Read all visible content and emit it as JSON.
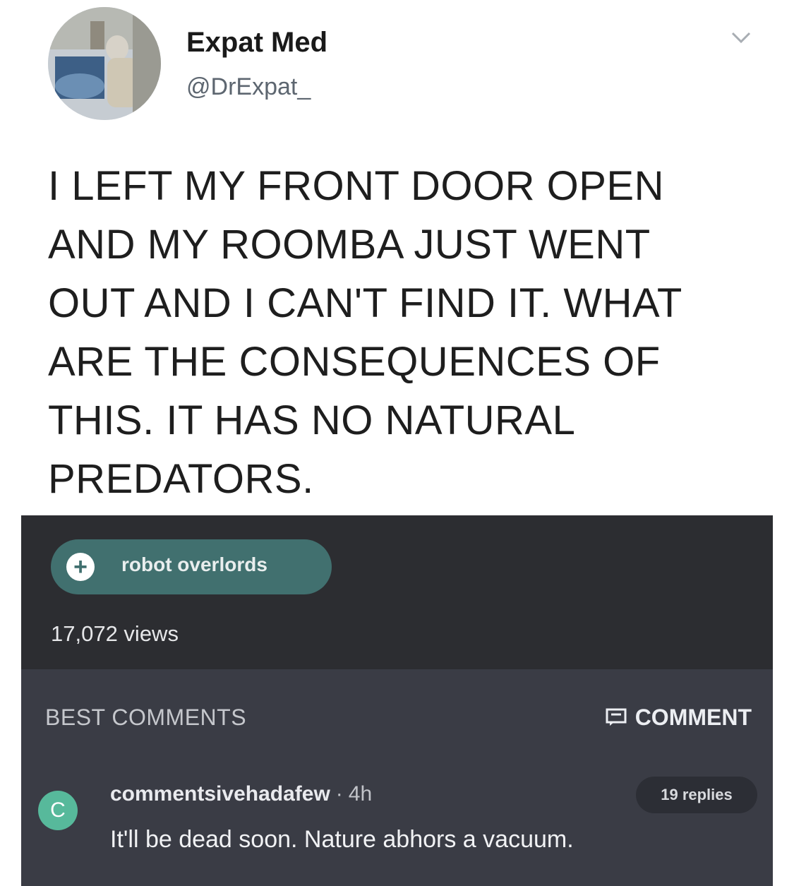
{
  "tweet": {
    "display_name": "Expat Med",
    "handle": "@DrExpat_",
    "lines": [
      "I LEFT MY FRONT DOOR OPEN",
      "AND MY ROOMBA JUST WENT",
      "OUT AND I CAN'T FIND IT. WHAT",
      "ARE THE CONSEQUENCES OF",
      "THIS. IT HAS NO NATURAL",
      "PREDATORS."
    ]
  },
  "post": {
    "tag_label": "robot overlords",
    "views": "17,072 views"
  },
  "comments": {
    "section_label": "BEST COMMENTS",
    "comment_button_label": "COMMENT",
    "items": [
      {
        "avatar_letter": "C",
        "username": "commentsivehadafew",
        "separator": "·",
        "time": "4h",
        "replies": "19 replies",
        "text": "It'll be dead soon. Nature abhors a vacuum."
      }
    ]
  },
  "colors": {
    "meta_bg": "#2c2d31",
    "comments_bg": "#3a3c45",
    "tag_bg": "#41706f",
    "comment_avatar": "#57b99b"
  },
  "icons": [
    "chevron-down-icon",
    "plus-icon",
    "comment-icon"
  ]
}
